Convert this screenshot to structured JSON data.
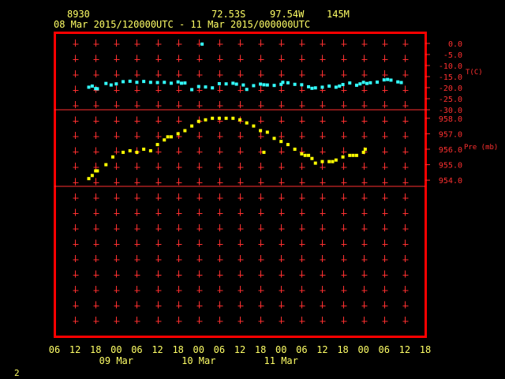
{
  "header": {
    "station_id": "8930",
    "latitude": "72.53S",
    "longitude": "97.54W",
    "elevation": "145M",
    "date_range": "08 Mar 2015/120000UTC - 11 Mar 2015/000000UTC"
  },
  "footer": {
    "page_number": "2"
  },
  "colors": {
    "background": "#000000",
    "frame": "#ff0000",
    "grid": "#ff3030",
    "temperature": "#33ffff",
    "pressure": "#ffff00",
    "header_text": "#ffff66",
    "axis_text": "#ff3030"
  },
  "chart_data": [
    {
      "type": "scatter",
      "ylabel": "T(C)",
      "ylim": [
        -30,
        0
      ],
      "yticks": [
        "0.0",
        "-5.0",
        "-10.0",
        "-15.0",
        "-20.0",
        "-25.0",
        "-30.0"
      ],
      "ytick_values": [
        0,
        -5,
        -10,
        -15,
        -20,
        -25,
        -30
      ],
      "x_unit": "hours since 08 Mar 2015 06UTC",
      "series": [
        {
          "points": [
            [
              10,
              -19.8
            ],
            [
              11,
              -19.3
            ],
            [
              12,
              -20.4
            ],
            [
              12.5,
              -20.5
            ],
            [
              15,
              -18.1
            ],
            [
              16.5,
              -18.8
            ],
            [
              18,
              -18.3
            ],
            [
              20,
              -17.3
            ],
            [
              22,
              -17.1
            ],
            [
              24,
              -17.6
            ],
            [
              26,
              -17.2
            ],
            [
              28,
              -17.6
            ],
            [
              30,
              -17.7
            ],
            [
              32,
              -17.6
            ],
            [
              34,
              -18.0
            ],
            [
              36,
              -17.4
            ],
            [
              37,
              -18.0
            ],
            [
              38,
              -17.9
            ],
            [
              40,
              -20.9
            ],
            [
              42,
              -19.5
            ],
            [
              43,
              -0.3
            ],
            [
              44,
              -19.7
            ],
            [
              46,
              -20.1
            ],
            [
              48,
              -18.2
            ],
            [
              50,
              -18.3
            ],
            [
              52,
              -18.0
            ],
            [
              53,
              -18.4
            ],
            [
              55,
              -18.8
            ],
            [
              56,
              -20.8
            ],
            [
              58,
              -19.1
            ],
            [
              60,
              -18.4
            ],
            [
              61,
              -18.7
            ],
            [
              62,
              -18.8
            ],
            [
              64,
              -19.0
            ],
            [
              66,
              -18.5
            ],
            [
              66.5,
              -17.6
            ],
            [
              68,
              -17.8
            ],
            [
              70,
              -18.5
            ],
            [
              72,
              -18.7
            ],
            [
              74,
              -19.6
            ],
            [
              75,
              -20.3
            ],
            [
              76,
              -20.1
            ],
            [
              78,
              -19.8
            ],
            [
              80,
              -19.3
            ],
            [
              82,
              -19.8
            ],
            [
              83,
              -19.3
            ],
            [
              84,
              -18.6
            ],
            [
              86,
              -17.9
            ],
            [
              88,
              -18.9
            ],
            [
              89,
              -18.3
            ],
            [
              90,
              -17.6
            ],
            [
              91,
              -18.1
            ],
            [
              92,
              -17.8
            ],
            [
              94,
              -17.5
            ],
            [
              96,
              -16.5
            ],
            [
              97,
              -16.3
            ],
            [
              98,
              -16.6
            ],
            [
              100,
              -17.4
            ],
            [
              101,
              -17.7
            ]
          ]
        }
      ]
    },
    {
      "type": "scatter",
      "ylabel": "Pre (mb)",
      "ylim": [
        953.6,
        958.5
      ],
      "yticks": [
        "958.0",
        "957.0",
        "956.0",
        "955.0",
        "954.0"
      ],
      "ytick_values": [
        958,
        957,
        956,
        955,
        954
      ],
      "x_unit": "hours since 08 Mar 2015 06UTC",
      "series": [
        {
          "points": [
            [
              10,
              954.1
            ],
            [
              11,
              954.3
            ],
            [
              12,
              954.6
            ],
            [
              12.5,
              954.6
            ],
            [
              15,
              955.0
            ],
            [
              17,
              955.5
            ],
            [
              20,
              955.8
            ],
            [
              22,
              955.9
            ],
            [
              24,
              955.8
            ],
            [
              26,
              956.0
            ],
            [
              28,
              955.9
            ],
            [
              30,
              956.3
            ],
            [
              32,
              956.6
            ],
            [
              33,
              956.8
            ],
            [
              34,
              956.8
            ],
            [
              36,
              957.0
            ],
            [
              38,
              957.2
            ],
            [
              40,
              957.5
            ],
            [
              42,
              957.8
            ],
            [
              44,
              957.9
            ],
            [
              46,
              958.0
            ],
            [
              48,
              958.0
            ],
            [
              50,
              958.0
            ],
            [
              52,
              958.0
            ],
            [
              54,
              957.9
            ],
            [
              56,
              957.7
            ],
            [
              58,
              957.5
            ],
            [
              60,
              957.2
            ],
            [
              61,
              955.8
            ],
            [
              62,
              957.1
            ],
            [
              64,
              956.7
            ],
            [
              66,
              956.5
            ],
            [
              68,
              956.3
            ],
            [
              70,
              956.0
            ],
            [
              72,
              955.7
            ],
            [
              73,
              955.6
            ],
            [
              74,
              955.6
            ],
            [
              75,
              955.4
            ],
            [
              76,
              955.1
            ],
            [
              78,
              955.2
            ],
            [
              80,
              955.2
            ],
            [
              81,
              955.2
            ],
            [
              82,
              955.3
            ],
            [
              84,
              955.5
            ],
            [
              86,
              955.6
            ],
            [
              87,
              955.6
            ],
            [
              88,
              955.6
            ],
            [
              90,
              955.8
            ],
            [
              90.5,
              956.0
            ]
          ]
        }
      ]
    }
  ],
  "x_axis": {
    "xlim": [
      0,
      108
    ],
    "tick_values": [
      0,
      6,
      12,
      18,
      24,
      30,
      36,
      42,
      48,
      54,
      60,
      66,
      72,
      78,
      84,
      90,
      96,
      102,
      108
    ],
    "tick_labels": [
      "06",
      "12",
      "18",
      "00",
      "06",
      "12",
      "18",
      "00",
      "06",
      "12",
      "18",
      "00",
      "06",
      "12",
      "18",
      "00",
      "06",
      "12",
      "18"
    ],
    "visible_ticks": [
      0,
      6,
      12,
      18,
      24,
      30,
      36,
      42,
      48,
      54,
      60,
      66,
      72,
      78,
      84,
      90,
      96,
      102,
      108
    ],
    "date_labels": [
      {
        "hour": 18,
        "label": "09 Mar"
      },
      {
        "hour": 42,
        "label": "10 Mar"
      },
      {
        "hour": 66,
        "label": "11 Mar"
      }
    ]
  }
}
